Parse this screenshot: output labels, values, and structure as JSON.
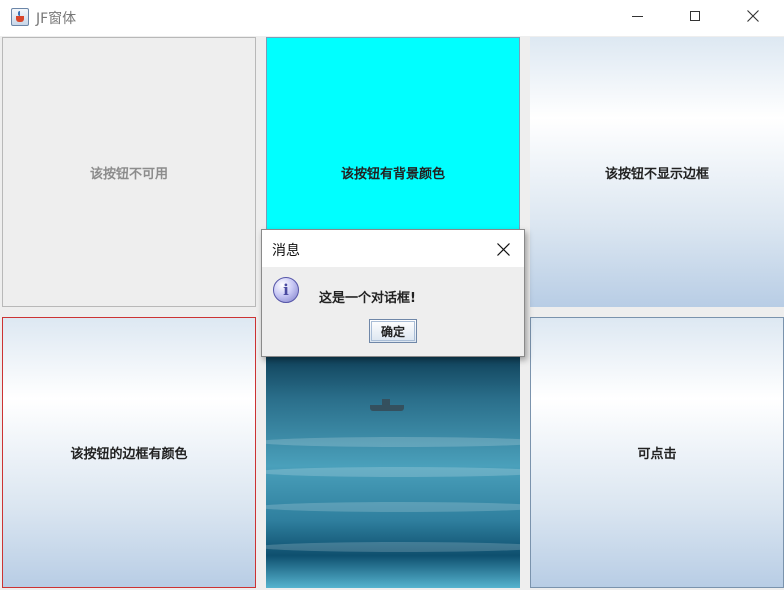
{
  "window": {
    "title": "JF窗体"
  },
  "buttons": {
    "disabled": "该按钮不可用",
    "background_color": "该按钮有背景颜色",
    "no_border": "该按钮不显示边框",
    "colored_border": "该按钮的边框有颜色",
    "clickable": "可点击"
  },
  "dialog": {
    "title": "消息",
    "message": "这是一个对话框!",
    "ok_label": "确定"
  },
  "colors": {
    "cyan_button": "#00ffff",
    "red_border": "#cc3333"
  },
  "icons": {
    "app": "java-cup-icon",
    "info": "information-icon"
  }
}
